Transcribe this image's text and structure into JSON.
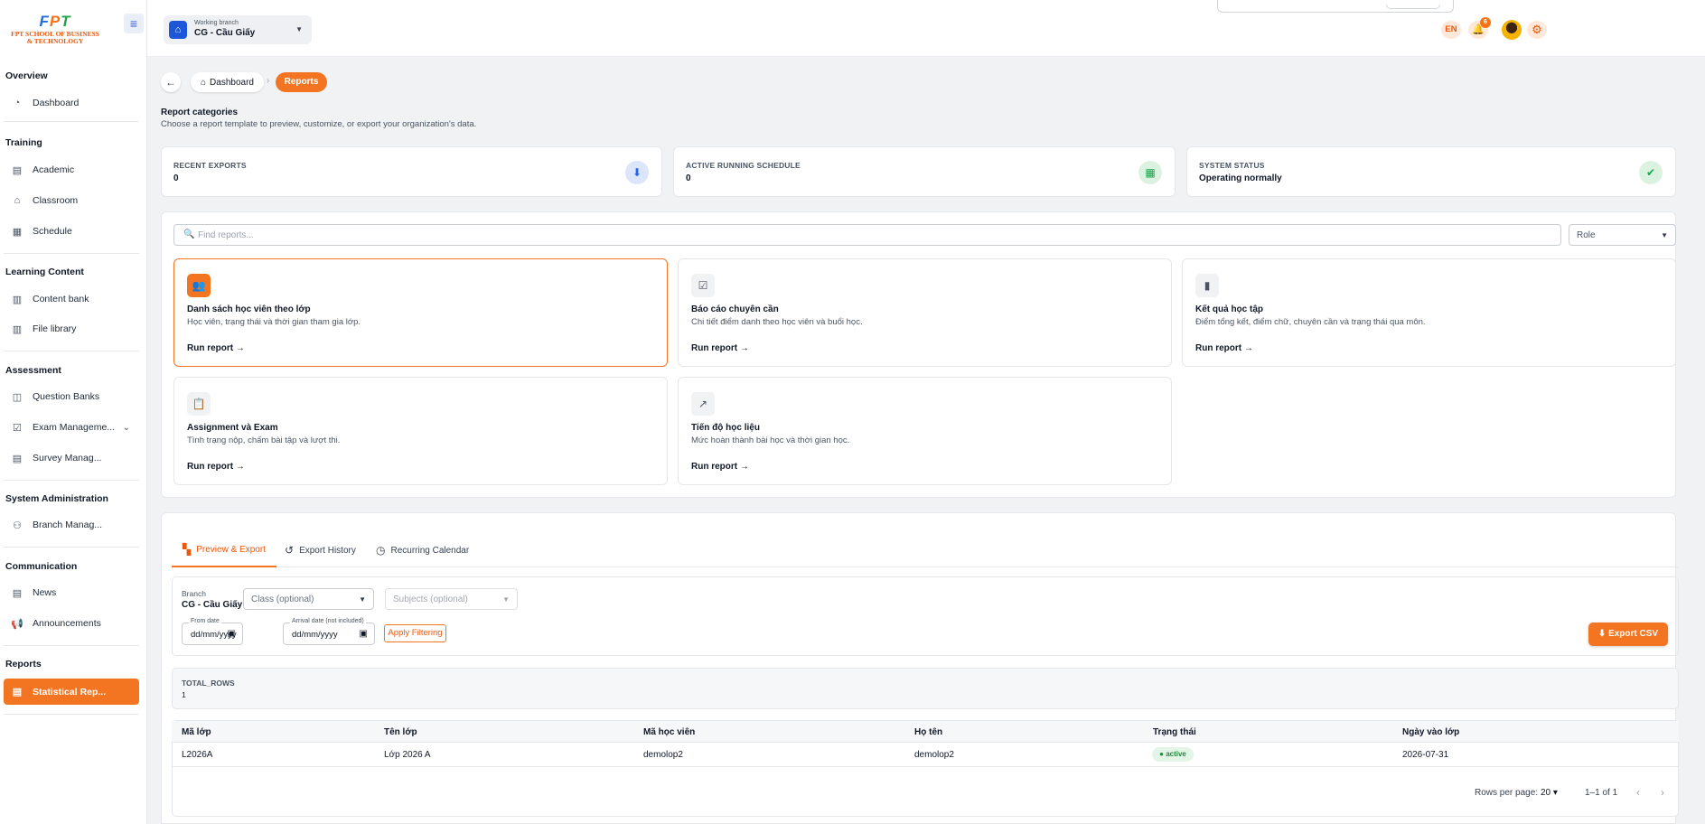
{
  "brand": {
    "logo_mark": "FPT",
    "logo_line1": "FPT SCHOOL OF BUSINESS",
    "logo_line2": "& TECHNOLOGY"
  },
  "sidebar": {
    "sections": [
      {
        "title": "Overview",
        "items": [
          {
            "label": "Dashboard",
            "icon": "dashboard-icon"
          }
        ]
      },
      {
        "title": "Training",
        "items": [
          {
            "label": "Academic",
            "icon": "academic-icon"
          },
          {
            "label": "Classroom",
            "icon": "classroom-icon"
          },
          {
            "label": "Schedule",
            "icon": "calendar-icon"
          }
        ]
      },
      {
        "title": "Learning Content",
        "items": [
          {
            "label": "Content bank",
            "icon": "content-bank-icon"
          },
          {
            "label": "File library",
            "icon": "file-library-icon"
          }
        ]
      },
      {
        "title": "Assessment",
        "items": [
          {
            "label": "Question Banks",
            "icon": "book-icon"
          },
          {
            "label": "Exam Manageme...",
            "icon": "exam-icon"
          },
          {
            "label": "Survey Manag...",
            "icon": "survey-icon"
          }
        ]
      },
      {
        "title": "System Administration",
        "items": [
          {
            "label": "Branch Manag...",
            "icon": "branch-user-icon"
          }
        ]
      },
      {
        "title": "Communication",
        "items": [
          {
            "label": "News",
            "icon": "news-icon"
          },
          {
            "label": "Announcements",
            "icon": "megaphone-icon"
          }
        ]
      },
      {
        "title": "Reports",
        "items": [
          {
            "label": "Statistical Rep...",
            "icon": "report-icon",
            "active": true
          }
        ]
      }
    ]
  },
  "topbar": {
    "branch_caption": "Working branch",
    "branch_name": "CG - Cầu Giấy",
    "language": "EN",
    "notification_count": "6"
  },
  "breadcrumb": {
    "home": "Dashboard",
    "current": "Reports"
  },
  "header": {
    "title": "Report categories",
    "subtitle": "Choose a report template to preview, customize, or export your organization's data."
  },
  "stats": [
    {
      "label": "RECENT EXPORTS",
      "value": "0",
      "icon": "download-icon",
      "color": "#2563eb"
    },
    {
      "label": "ACTIVE RUNNING SCHEDULE",
      "value": "0",
      "icon": "calendar-check-icon",
      "color": "#16a34a"
    },
    {
      "label": "SYSTEM STATUS",
      "value": "Operating normally",
      "icon": "check-circle-icon",
      "color": "#16a34a"
    }
  ],
  "search": {
    "placeholder": "Find reports...",
    "role_label": "Role"
  },
  "report_cards": [
    {
      "title": "Danh sách học viên theo lớp",
      "desc": "Học viên, trạng thái và thời gian tham gia lớp.",
      "action": "Run report →",
      "icon": "group-icon"
    },
    {
      "title": "Báo cáo chuyên cần",
      "desc": "Chi tiết điểm danh theo học viên và buổi học.",
      "action": "Run report →",
      "icon": "checklist-icon"
    },
    {
      "title": "Kết quả học tập",
      "desc": "Điểm tổng kết, điểm chữ, chuyên cần và trạng thái qua môn.",
      "action": "Run report →",
      "icon": "bar-chart-icon"
    },
    {
      "title": "Assignment và Exam",
      "desc": "Tình trạng nộp, chấm bài tập và lượt thi.",
      "action": "Run report →",
      "icon": "clipboard-icon"
    },
    {
      "title": "Tiến độ học liệu",
      "desc": "Mức hoàn thành bài học và thời gian học.",
      "action": "Run report →",
      "icon": "trending-icon"
    }
  ],
  "tabs": [
    {
      "label": "Preview & Export",
      "icon": "dashboard-grid-icon"
    },
    {
      "label": "Export History",
      "icon": "history-icon"
    },
    {
      "label": "Recurring Calendar",
      "icon": "clock-icon"
    }
  ],
  "filters": {
    "branch_label": "Branch",
    "branch_value": "CG - Cầu Giấy",
    "class_placeholder": "Class (optional)",
    "subjects_placeholder": "Subjects (optional)",
    "from_label": "From date",
    "from_value": "dd/mm/yyyy",
    "arrival_label": "Arrival date (not included)",
    "arrival_value": "dd/mm/yyyy",
    "apply_label": "Apply Filtering",
    "export_label": "Export CSV"
  },
  "summary": {
    "label": "TOTAL_ROWS",
    "value": "1"
  },
  "table": {
    "columns": [
      "Mã lớp",
      "Tên lớp",
      "Mã học viên",
      "Họ tên",
      "Trạng thái",
      "Ngày vào lớp"
    ],
    "rows": [
      [
        "L2026A",
        "Lớp 2026 A",
        "demolop2",
        "demolop2",
        "active",
        "2026-07-31"
      ]
    ]
  },
  "pagination": {
    "rows_per_page_label": "Rows per page:",
    "rows_per_page_value": "20",
    "range": "1–1 of 1"
  },
  "colors": {
    "accent": "#f47521",
    "primary_blue": "#1e56d9",
    "success": "#16a34a"
  }
}
